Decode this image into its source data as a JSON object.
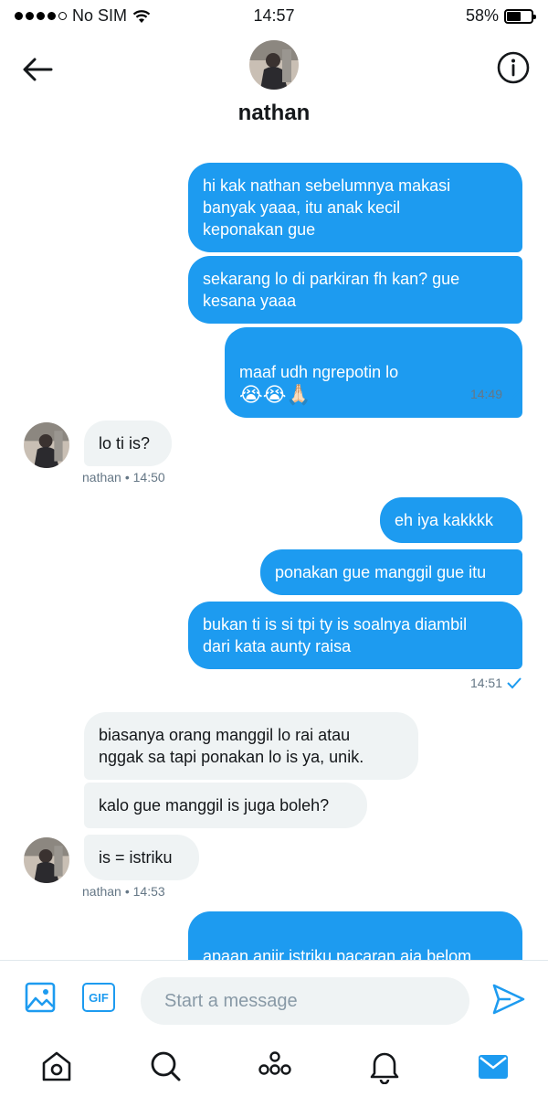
{
  "status_bar": {
    "carrier": "No SIM",
    "time": "14:57",
    "battery_percent": "58%",
    "battery_level": 0.58
  },
  "header": {
    "name": "nathan",
    "back_icon": "back-arrow-icon",
    "info_icon": "info-icon"
  },
  "messages": {
    "m1": "hi kak nathan sebelumnya makasi\nbanyak yaaa, itu anak kecil\nkeponakan gue",
    "m2": "sekarang lo di parkiran fh kan? gue\nkesana yaaa",
    "m3_text": "maaf udh ngrepotin lo",
    "m3_emoji": "😭😭🙏🏻",
    "m3_time": "14:49",
    "m4": "lo ti is?",
    "m4_sender": "nathan",
    "m4_time": "• 14:50",
    "m5": "eh iya kakkkk",
    "m6": "ponakan gue manggil gue itu",
    "m7": "bukan ti is si tpi ty is soalnya diambil\ndari kata aunty raisa",
    "m7_time": "14:51",
    "m8": "biasanya orang manggil lo rai atau\nnggak sa tapi ponakan lo is ya, unik.",
    "m9": "kalo gue manggil is juga boleh?",
    "m10": "is = istriku",
    "m10_sender": "nathan",
    "m10_time": "• 14:53",
    "m11_text": "apaan anjir istriku pacaran aja belom",
    "m11_emoji": "😂😂😂"
  },
  "composer": {
    "gif_label": "GIF",
    "placeholder": "Start a message"
  },
  "tabs": [
    "home-icon",
    "search-icon",
    "spaces-icon",
    "notifications-icon",
    "messages-icon"
  ],
  "colors": {
    "accent": "#1d9bf0",
    "incoming_bubble": "#eff3f4",
    "meta_text": "#657786"
  }
}
